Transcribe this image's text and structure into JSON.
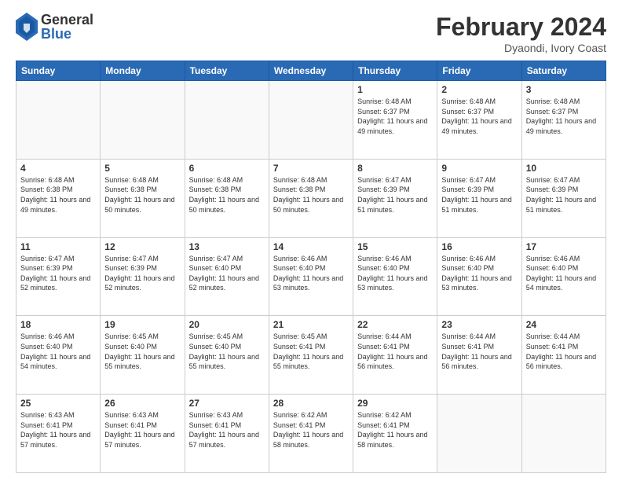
{
  "header": {
    "logo": {
      "general": "General",
      "blue": "Blue"
    },
    "title": "February 2024",
    "location": "Dyaondi, Ivory Coast"
  },
  "days_of_week": [
    "Sunday",
    "Monday",
    "Tuesday",
    "Wednesday",
    "Thursday",
    "Friday",
    "Saturday"
  ],
  "weeks": [
    [
      {
        "day": "",
        "info": ""
      },
      {
        "day": "",
        "info": ""
      },
      {
        "day": "",
        "info": ""
      },
      {
        "day": "",
        "info": ""
      },
      {
        "day": "1",
        "info": "Sunrise: 6:48 AM\nSunset: 6:37 PM\nDaylight: 11 hours and 49 minutes."
      },
      {
        "day": "2",
        "info": "Sunrise: 6:48 AM\nSunset: 6:37 PM\nDaylight: 11 hours and 49 minutes."
      },
      {
        "day": "3",
        "info": "Sunrise: 6:48 AM\nSunset: 6:37 PM\nDaylight: 11 hours and 49 minutes."
      }
    ],
    [
      {
        "day": "4",
        "info": "Sunrise: 6:48 AM\nSunset: 6:38 PM\nDaylight: 11 hours and 49 minutes."
      },
      {
        "day": "5",
        "info": "Sunrise: 6:48 AM\nSunset: 6:38 PM\nDaylight: 11 hours and 50 minutes."
      },
      {
        "day": "6",
        "info": "Sunrise: 6:48 AM\nSunset: 6:38 PM\nDaylight: 11 hours and 50 minutes."
      },
      {
        "day": "7",
        "info": "Sunrise: 6:48 AM\nSunset: 6:38 PM\nDaylight: 11 hours and 50 minutes."
      },
      {
        "day": "8",
        "info": "Sunrise: 6:47 AM\nSunset: 6:39 PM\nDaylight: 11 hours and 51 minutes."
      },
      {
        "day": "9",
        "info": "Sunrise: 6:47 AM\nSunset: 6:39 PM\nDaylight: 11 hours and 51 minutes."
      },
      {
        "day": "10",
        "info": "Sunrise: 6:47 AM\nSunset: 6:39 PM\nDaylight: 11 hours and 51 minutes."
      }
    ],
    [
      {
        "day": "11",
        "info": "Sunrise: 6:47 AM\nSunset: 6:39 PM\nDaylight: 11 hours and 52 minutes."
      },
      {
        "day": "12",
        "info": "Sunrise: 6:47 AM\nSunset: 6:39 PM\nDaylight: 11 hours and 52 minutes."
      },
      {
        "day": "13",
        "info": "Sunrise: 6:47 AM\nSunset: 6:40 PM\nDaylight: 11 hours and 52 minutes."
      },
      {
        "day": "14",
        "info": "Sunrise: 6:46 AM\nSunset: 6:40 PM\nDaylight: 11 hours and 53 minutes."
      },
      {
        "day": "15",
        "info": "Sunrise: 6:46 AM\nSunset: 6:40 PM\nDaylight: 11 hours and 53 minutes."
      },
      {
        "day": "16",
        "info": "Sunrise: 6:46 AM\nSunset: 6:40 PM\nDaylight: 11 hours and 53 minutes."
      },
      {
        "day": "17",
        "info": "Sunrise: 6:46 AM\nSunset: 6:40 PM\nDaylight: 11 hours and 54 minutes."
      }
    ],
    [
      {
        "day": "18",
        "info": "Sunrise: 6:46 AM\nSunset: 6:40 PM\nDaylight: 11 hours and 54 minutes."
      },
      {
        "day": "19",
        "info": "Sunrise: 6:45 AM\nSunset: 6:40 PM\nDaylight: 11 hours and 55 minutes."
      },
      {
        "day": "20",
        "info": "Sunrise: 6:45 AM\nSunset: 6:40 PM\nDaylight: 11 hours and 55 minutes."
      },
      {
        "day": "21",
        "info": "Sunrise: 6:45 AM\nSunset: 6:41 PM\nDaylight: 11 hours and 55 minutes."
      },
      {
        "day": "22",
        "info": "Sunrise: 6:44 AM\nSunset: 6:41 PM\nDaylight: 11 hours and 56 minutes."
      },
      {
        "day": "23",
        "info": "Sunrise: 6:44 AM\nSunset: 6:41 PM\nDaylight: 11 hours and 56 minutes."
      },
      {
        "day": "24",
        "info": "Sunrise: 6:44 AM\nSunset: 6:41 PM\nDaylight: 11 hours and 56 minutes."
      }
    ],
    [
      {
        "day": "25",
        "info": "Sunrise: 6:43 AM\nSunset: 6:41 PM\nDaylight: 11 hours and 57 minutes."
      },
      {
        "day": "26",
        "info": "Sunrise: 6:43 AM\nSunset: 6:41 PM\nDaylight: 11 hours and 57 minutes."
      },
      {
        "day": "27",
        "info": "Sunrise: 6:43 AM\nSunset: 6:41 PM\nDaylight: 11 hours and 57 minutes."
      },
      {
        "day": "28",
        "info": "Sunrise: 6:42 AM\nSunset: 6:41 PM\nDaylight: 11 hours and 58 minutes."
      },
      {
        "day": "29",
        "info": "Sunrise: 6:42 AM\nSunset: 6:41 PM\nDaylight: 11 hours and 58 minutes."
      },
      {
        "day": "",
        "info": ""
      },
      {
        "day": "",
        "info": ""
      }
    ]
  ]
}
